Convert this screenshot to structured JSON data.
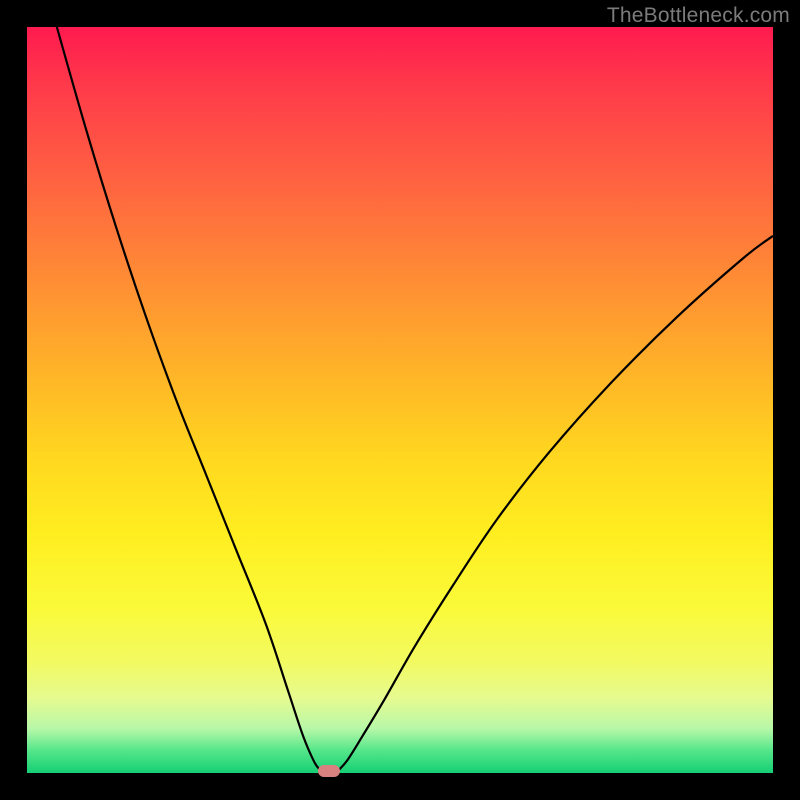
{
  "watermark": "TheBottleneck.com",
  "colors": {
    "frame": "#000000",
    "curve": "#000000",
    "dot": "#d98181",
    "gradient_top": "#ff1a4f",
    "gradient_bottom": "#15cf74"
  },
  "chart_data": {
    "type": "line",
    "title": "",
    "xlabel": "",
    "ylabel": "",
    "xlim": [
      0,
      100
    ],
    "ylim": [
      0,
      100
    ],
    "grid": false,
    "legend": false,
    "annotations": [],
    "series": [
      {
        "name": "left-branch",
        "x": [
          4,
          8,
          12,
          16,
          20,
          24,
          28,
          32,
          35,
          37,
          38.5,
          39.3
        ],
        "y": [
          100,
          86,
          73,
          61,
          50,
          40,
          30,
          20,
          11,
          5,
          1.5,
          0.4
        ]
      },
      {
        "name": "right-branch",
        "x": [
          41.8,
          43,
          45,
          48,
          52,
          57,
          63,
          70,
          78,
          87,
          96,
          100
        ],
        "y": [
          0.4,
          1.8,
          5,
          10,
          17,
          25,
          34,
          43,
          52,
          61,
          69,
          72
        ]
      }
    ],
    "minimum_marker": {
      "x": 40.5,
      "y": 0.3
    }
  }
}
